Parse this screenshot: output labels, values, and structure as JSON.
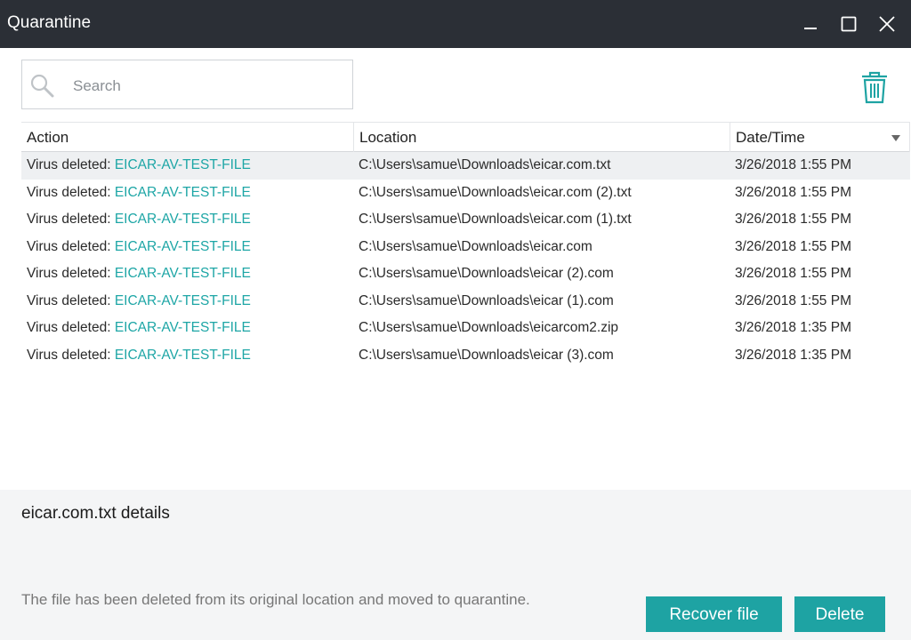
{
  "window": {
    "title": "Quarantine"
  },
  "search": {
    "placeholder": "Search"
  },
  "table": {
    "columns": [
      "Action",
      "Location",
      "Date/Time"
    ],
    "rows": [
      {
        "action": "Virus deleted: ",
        "threat": "EICAR-AV-TEST-FILE",
        "location": "C:\\Users\\samue\\Downloads\\eicar.com.txt",
        "datetime": "3/26/2018 1:55 PM"
      },
      {
        "action": "Virus deleted: ",
        "threat": "EICAR-AV-TEST-FILE",
        "location": "C:\\Users\\samue\\Downloads\\eicar.com (2).txt",
        "datetime": "3/26/2018 1:55 PM"
      },
      {
        "action": "Virus deleted: ",
        "threat": "EICAR-AV-TEST-FILE",
        "location": "C:\\Users\\samue\\Downloads\\eicar.com (1).txt",
        "datetime": "3/26/2018 1:55 PM"
      },
      {
        "action": "Virus deleted: ",
        "threat": "EICAR-AV-TEST-FILE",
        "location": "C:\\Users\\samue\\Downloads\\eicar.com",
        "datetime": "3/26/2018 1:55 PM"
      },
      {
        "action": "Virus deleted: ",
        "threat": "EICAR-AV-TEST-FILE",
        "location": "C:\\Users\\samue\\Downloads\\eicar (2).com",
        "datetime": "3/26/2018 1:55 PM"
      },
      {
        "action": "Virus deleted: ",
        "threat": "EICAR-AV-TEST-FILE",
        "location": "C:\\Users\\samue\\Downloads\\eicar (1).com",
        "datetime": "3/26/2018 1:55 PM"
      },
      {
        "action": "Virus deleted: ",
        "threat": "EICAR-AV-TEST-FILE",
        "location": "C:\\Users\\samue\\Downloads\\eicarcom2.zip",
        "datetime": "3/26/2018 1:35 PM"
      },
      {
        "action": "Virus deleted: ",
        "threat": "EICAR-AV-TEST-FILE",
        "location": "C:\\Users\\samue\\Downloads\\eicar (3).com",
        "datetime": "3/26/2018 1:35 PM"
      }
    ]
  },
  "details": {
    "title": "eicar.com.txt details",
    "description": "The file has been deleted from its original location and moved to quarantine.",
    "recover_label": "Recover file",
    "delete_label": "Delete"
  },
  "colors": {
    "accent": "#1ea3a3",
    "titlebar": "#2b2f36",
    "threat_link": "#1ea6a6"
  },
  "icons": [
    "minimize-icon",
    "maximize-icon",
    "close-icon",
    "search-icon",
    "trash-icon",
    "sort-desc-icon"
  ]
}
